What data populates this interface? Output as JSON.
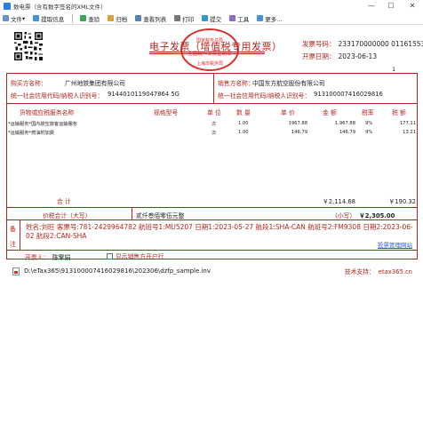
{
  "window": {
    "title": "数电票（含有数字签名的XML文件）",
    "minimize": "—",
    "maximize": "☐",
    "close": "✕"
  },
  "toolbar": {
    "file": "文件",
    "extract": "提取信息",
    "verify": "查验",
    "archive": "归档",
    "view_list": "查看列表",
    "print": "打印",
    "submit": "提交",
    "tools": "工具",
    "more": "更多..."
  },
  "invoice": {
    "title": "电子发票（增值税专用发票）",
    "seal_top": "国家税务总局",
    "seal_middle": "全国统一发票监制章",
    "seal_bottom": "上海市税务局",
    "number_label": "发票号码：",
    "number": "233170000000 01161553",
    "date_label": "开票日期：",
    "date": "2023-06-13",
    "page": "1",
    "buyer": {
      "section": "购买方信息",
      "name_label": "名称：",
      "name": "广州地铁集团有限公司",
      "id_label": "统一社会信用代码/纳税人识别号：",
      "id": "9144010119047864 5G"
    },
    "seller": {
      "section": "销售方信息",
      "name_label": "名称：",
      "name": "中国东方航空股份有限公司",
      "id_label": "统一社会信用代码/纳税人识别号：",
      "id": "913100007416029816"
    },
    "headers": {
      "item": "货物或应税服务名称",
      "spec": "规格型号",
      "unit": "单 位",
      "qty": "数 量",
      "price": "单 价",
      "amount": "金 额",
      "rate": "税率",
      "tax": "税 额"
    },
    "items": [
      {
        "name": "*运输服务*国内航空旅客运输服务",
        "unit": "次",
        "qty": "1.00",
        "price": "1967.88",
        "amount": "1,967.88",
        "rate": "9%",
        "tax": "177.11"
      },
      {
        "name": "*运输服务*燃油附加费",
        "unit": "次",
        "qty": "1.00",
        "price": "146.79",
        "amount": "146.79",
        "rate": "9%",
        "tax": "13.21"
      }
    ],
    "total_label": "合 计",
    "total_amount": "￥2,114.68",
    "total_tax": "￥190.32",
    "grand_label": "价税合计（大写）",
    "grand_words": "贰仟叁佰零伍元整",
    "grand_small_label": "（小写）",
    "grand_number": "￥2,305.00",
    "remarks_label_1": "备",
    "remarks_label_2": "注",
    "remarks": "姓名:刘旺 客票号:781-2429964782 航班号1:MU5207 日期1:2023-05-27 航段1:SHA-CAN 航班号2:FM9308 日期2:2023-06-02 航段2:CAN-SHA",
    "issuer_label": "开票人：",
    "issuer": "陈擎娟",
    "show_seller_account": "显示销售方开户行",
    "official_link": "投票管理网站"
  },
  "footer": {
    "path": "D:\\eTax365\\913100007416029816\\202306\\dzfp_sample.inv",
    "support_label": "技术支持：",
    "support_site": "etax365.cn"
  },
  "colors": {
    "invoice_red": "#b5241b",
    "seal_red": "#d8322a",
    "link_blue": "#2a5bd7"
  }
}
